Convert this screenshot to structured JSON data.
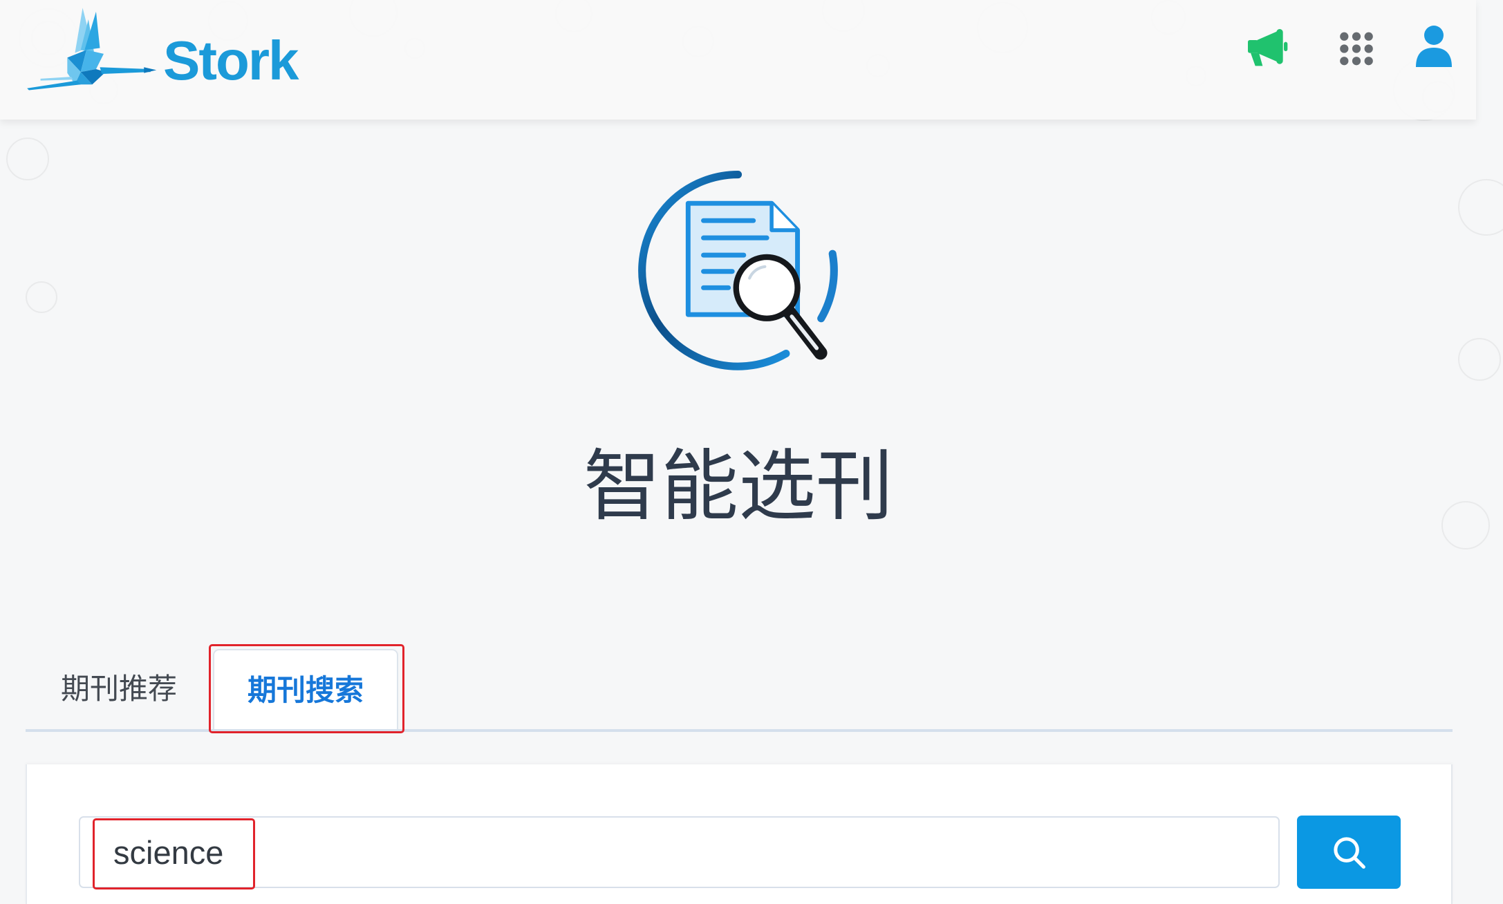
{
  "header": {
    "brand": "Stork",
    "icons": [
      "stork-logo",
      "megaphone-icon",
      "grid-icon",
      "user-icon"
    ]
  },
  "hero": {
    "title": "智能选刊",
    "icon": "document-search-icon"
  },
  "tabs": {
    "items": [
      {
        "label": "期刊推荐"
      },
      {
        "label": "期刊搜索"
      }
    ],
    "active": 1
  },
  "search": {
    "value": "science",
    "button_icon": "search-icon"
  },
  "colors": {
    "brand": "#1b9ad9",
    "announcement": "#20c26e",
    "active_tab": "#1677d9",
    "search_button": "#0b98e3",
    "title": "#2f3b4c",
    "highlight": "#e1232b",
    "background": "#f6f7f8"
  }
}
